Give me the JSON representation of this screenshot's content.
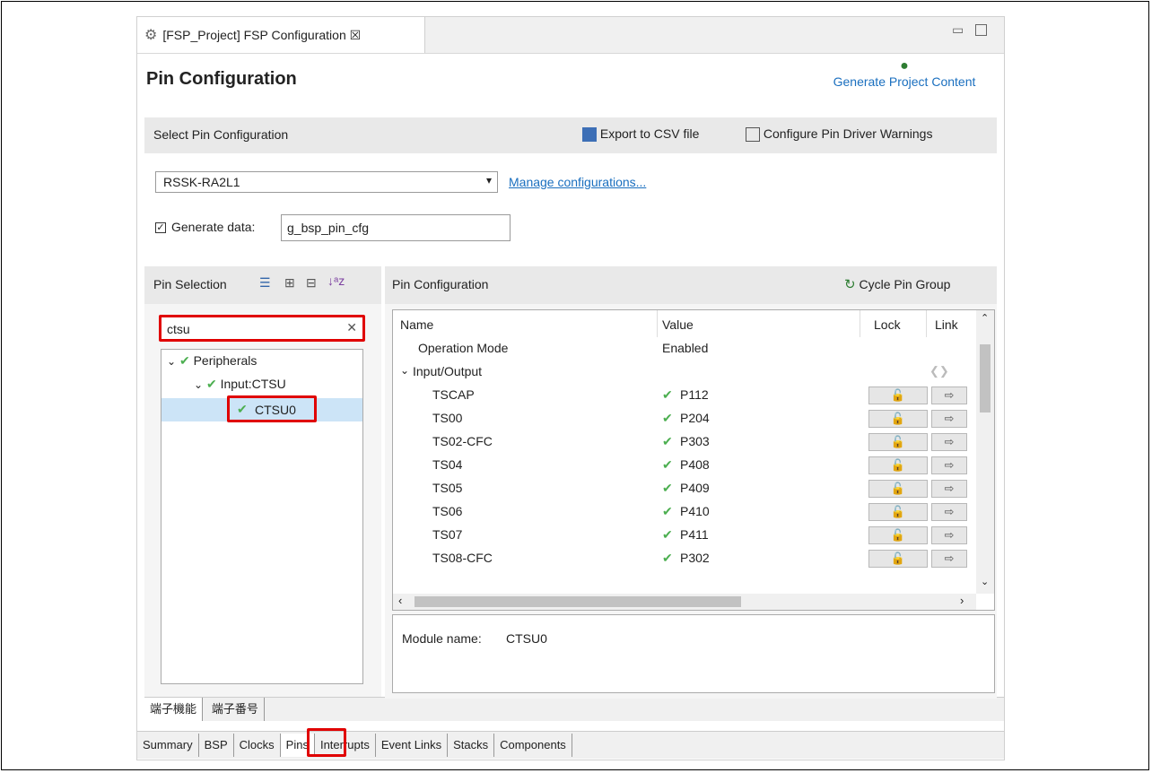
{
  "window": {
    "tab_title": "[FSP_Project] FSP Configuration ☒",
    "page_title": "Pin Configuration",
    "generate_label": "Generate Project Content"
  },
  "select_section": {
    "title": "Select Pin Configuration",
    "export_label": "Export to CSV file",
    "warnings_label": "Configure Pin Driver Warnings",
    "config_value": "RSSK-RA2L1",
    "manage_link": "Manage configurations...",
    "generate_data_label": "Generate data:",
    "generate_data_value": "g_bsp_pin_cfg"
  },
  "pin_selection": {
    "title": "Pin Selection",
    "search_value": "ctsu",
    "tree": [
      {
        "label": "Peripherals"
      },
      {
        "label": "Input:CTSU"
      },
      {
        "label": "CTSU0"
      }
    ],
    "tabs": [
      "端子機能",
      "端子番号"
    ]
  },
  "pin_config": {
    "title": "Pin Configuration",
    "cycle_label": "Cycle Pin Group",
    "columns": [
      "Name",
      "Value",
      "Lock",
      "Link"
    ],
    "operation_mode": {
      "name": "Operation Mode",
      "value": "Enabled"
    },
    "group": "Input/Output",
    "rows": [
      {
        "name": "TSCAP",
        "value": "P112"
      },
      {
        "name": "TS00",
        "value": "P204"
      },
      {
        "name": "TS02-CFC",
        "value": "P303"
      },
      {
        "name": "TS04",
        "value": "P408"
      },
      {
        "name": "TS05",
        "value": "P409"
      },
      {
        "name": "TS06",
        "value": "P410"
      },
      {
        "name": "TS07",
        "value": "P411"
      },
      {
        "name": "TS08-CFC",
        "value": "P302"
      }
    ],
    "module_label": "Module name:",
    "module_value": "CTSU0"
  },
  "bottom_tabs": [
    "Summary",
    "BSP",
    "Clocks",
    "Pins",
    "Interrupts",
    "Event Links",
    "Stacks",
    "Components"
  ],
  "colors": {
    "accent": "#1a6fbf",
    "highlight": "#e00000",
    "check": "#4caf50"
  }
}
